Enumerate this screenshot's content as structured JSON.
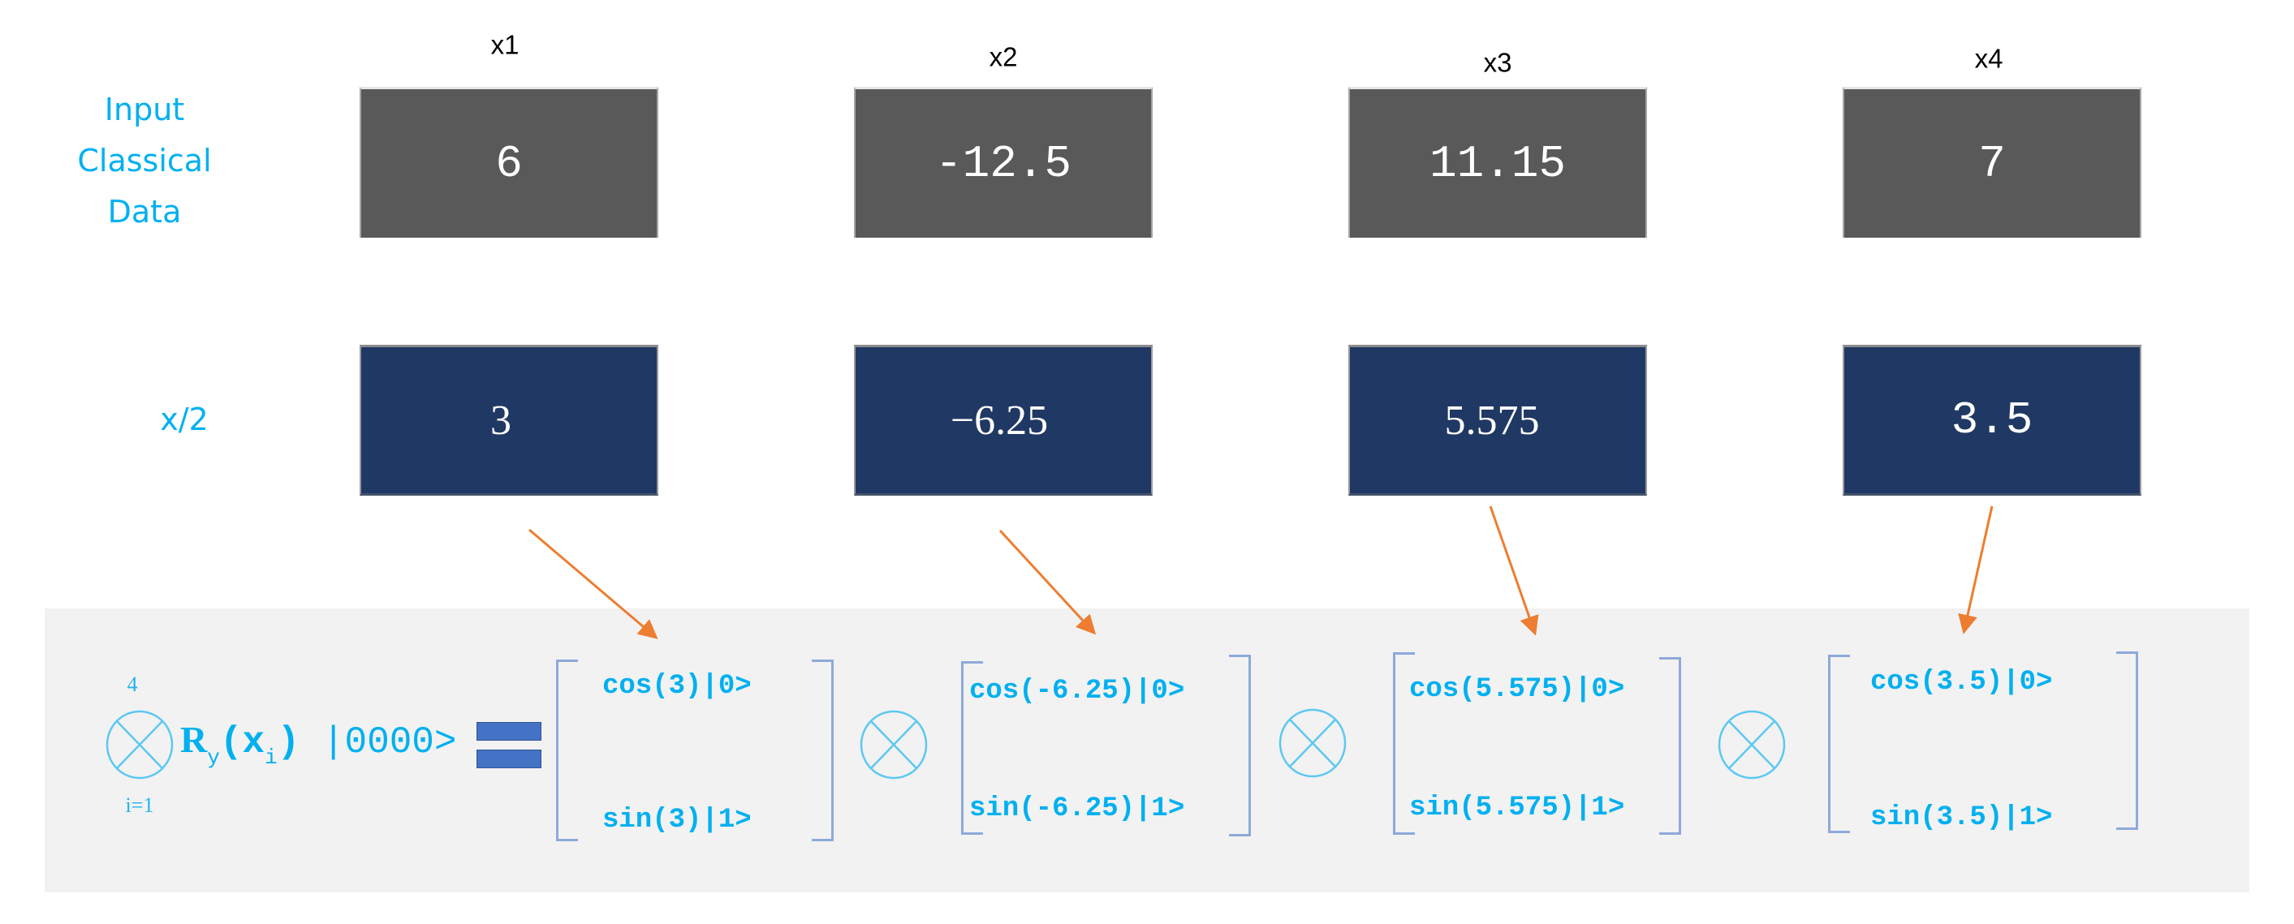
{
  "row_labels": {
    "input": [
      "Input",
      "Classical",
      "Data"
    ],
    "scaled": "x/2"
  },
  "columns": [
    {
      "header": "x1",
      "input_value": "6",
      "scaled_value": "3",
      "cos_entry": "cos(3)|0>",
      "sin_entry": "sin(3)|1>"
    },
    {
      "header": "x2",
      "input_value": "-12.5",
      "scaled_value": "−6.25",
      "cos_entry": "cos(-6.25)|0>",
      "sin_entry": "sin(-6.25)|1>"
    },
    {
      "header": "x3",
      "input_value": "11.15",
      "scaled_value": "5.575",
      "cos_entry": "cos(5.575)|0>",
      "sin_entry": "sin(5.575)|1>"
    },
    {
      "header": "x4",
      "input_value": "7",
      "scaled_value": "3.5",
      "cos_entry": "cos(3.5)|0>",
      "sin_entry": "sin(3.5)|1>"
    }
  ],
  "formula": {
    "product_upper": "4",
    "product_lower": "i=1",
    "operator": "R",
    "operator_sub": "y",
    "arg_open": "(x",
    "arg_sub": "i",
    "arg_close": ")",
    "ket": " |0000>"
  },
  "colors": {
    "input_box": "#595959",
    "scaled_box": "#203864",
    "accent_text": "#00B0F0",
    "arrow": "#ED7D31",
    "equals": "#4472C4",
    "panel": "#F2F2F2"
  }
}
